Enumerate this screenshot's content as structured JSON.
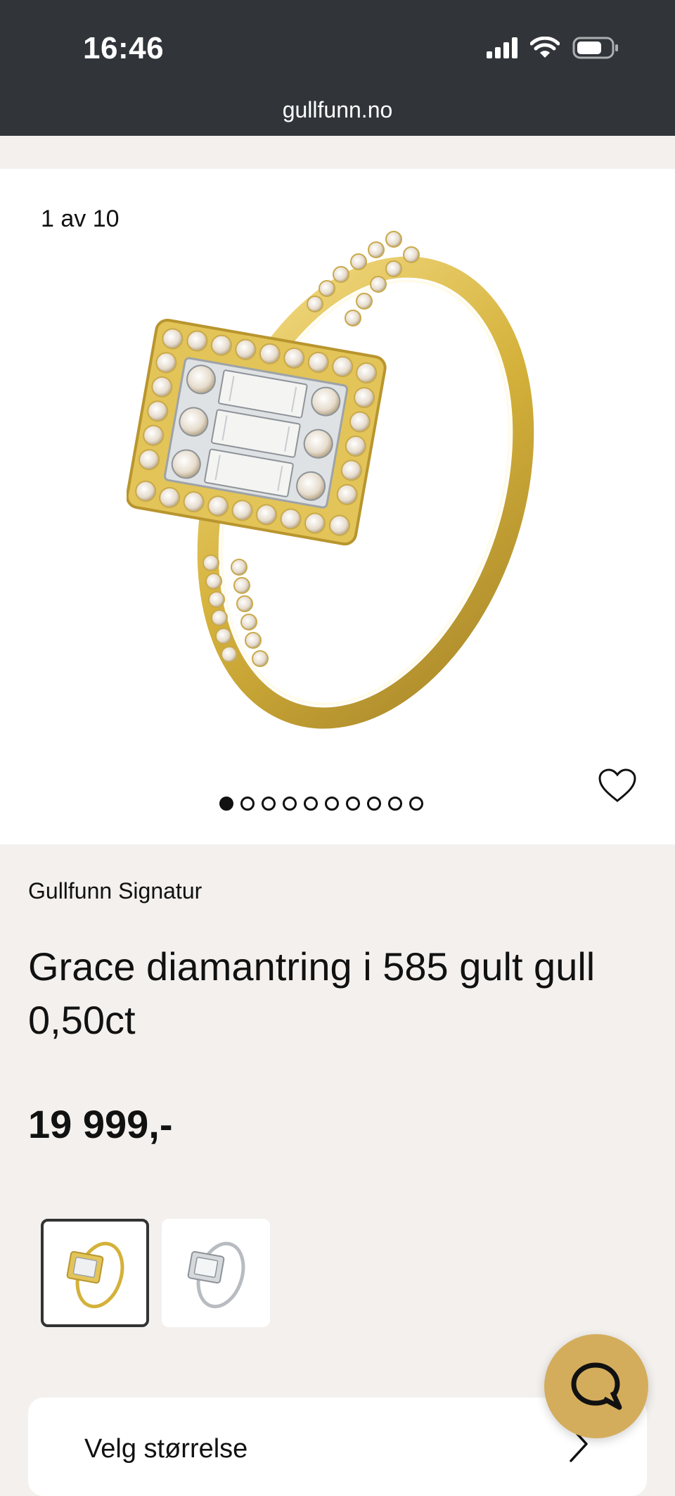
{
  "status_bar": {
    "time": "16:46"
  },
  "browser": {
    "url": "gullfunn.no"
  },
  "gallery": {
    "counter": "1 av 10",
    "total_images": 10,
    "active_index": 1
  },
  "product": {
    "brand": "Gullfunn Signatur",
    "title": "Grace diamantring i 585 gult gull 0,50ct",
    "price": "19 999,-"
  },
  "variants": [
    {
      "metal": "gult gull",
      "selected": true
    },
    {
      "metal": "hvitt gull",
      "selected": false
    }
  ],
  "size_selector": {
    "label": "Velg størrelse"
  },
  "colors": {
    "status_bg": "#31353a",
    "page_bg": "#f3f0ed",
    "chat_accent": "#d4ad5c"
  }
}
